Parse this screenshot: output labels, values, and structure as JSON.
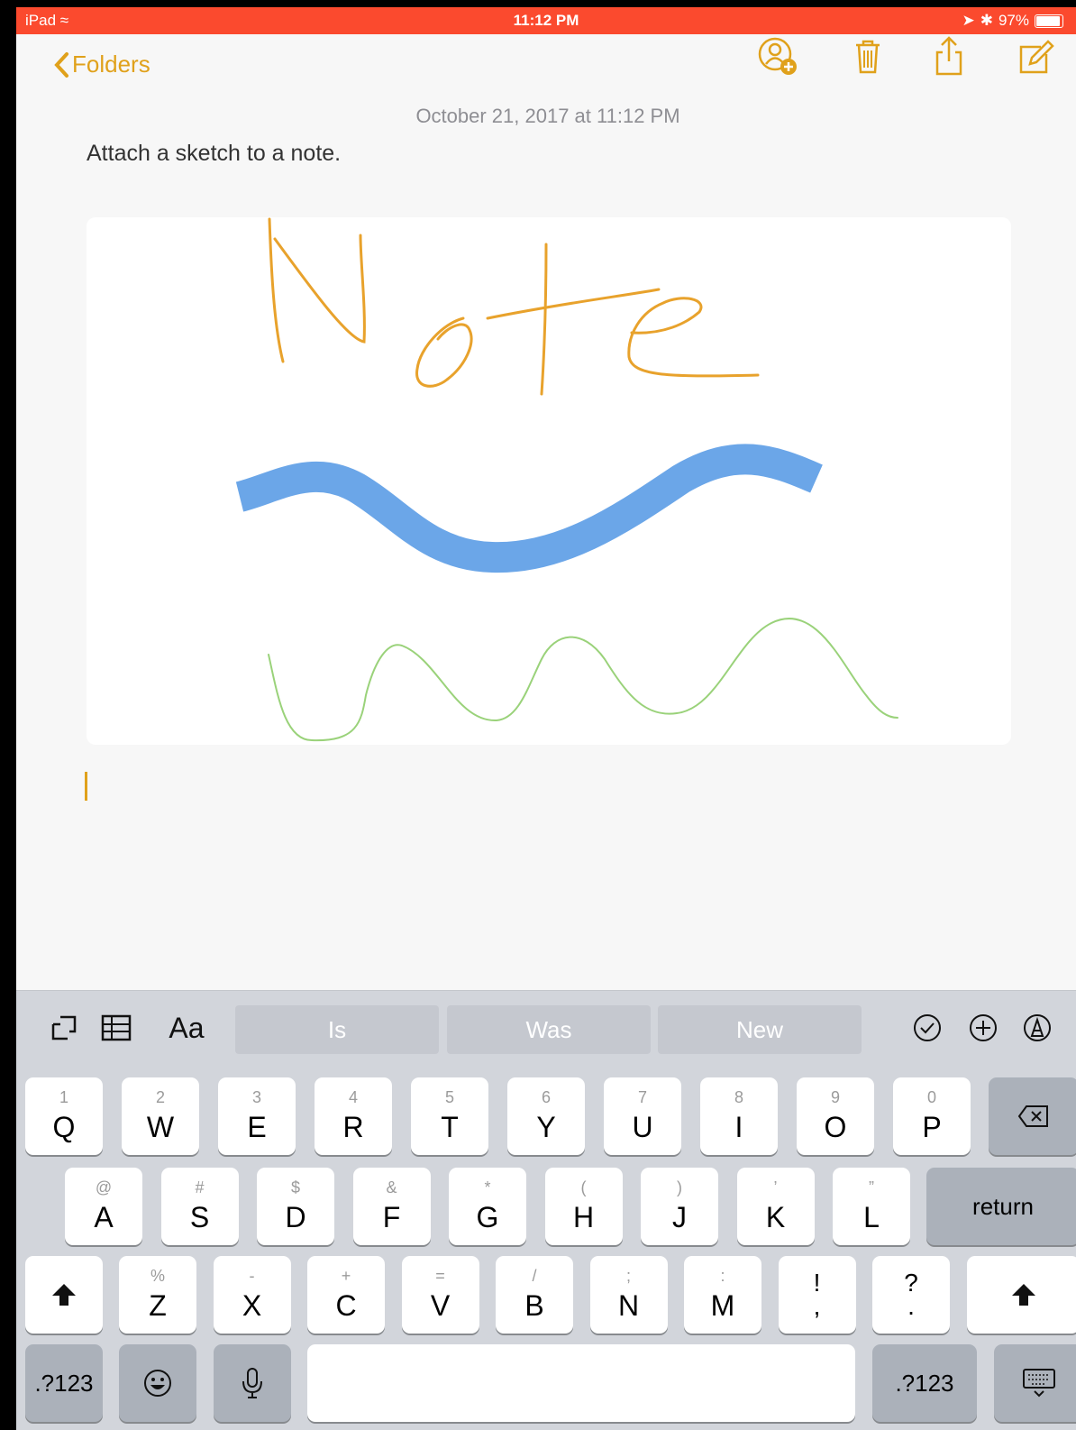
{
  "status": {
    "device": "iPad",
    "time": "11:12 PM",
    "battery": "97%"
  },
  "nav": {
    "back_label": "Folders"
  },
  "note": {
    "date": "October 21, 2017 at 11:12 PM",
    "text": "Attach a sketch to a note."
  },
  "keyboard": {
    "suggestions": [
      "Is",
      "Was",
      "New"
    ],
    "format_label": "Aa",
    "row1": [
      {
        "k": "Q",
        "s": "1"
      },
      {
        "k": "W",
        "s": "2"
      },
      {
        "k": "E",
        "s": "3"
      },
      {
        "k": "R",
        "s": "4"
      },
      {
        "k": "T",
        "s": "5"
      },
      {
        "k": "Y",
        "s": "6"
      },
      {
        "k": "U",
        "s": "7"
      },
      {
        "k": "I",
        "s": "8"
      },
      {
        "k": "O",
        "s": "9"
      },
      {
        "k": "P",
        "s": "0"
      }
    ],
    "row2": [
      {
        "k": "A",
        "s": "@"
      },
      {
        "k": "S",
        "s": "#"
      },
      {
        "k": "D",
        "s": "$"
      },
      {
        "k": "F",
        "s": "&"
      },
      {
        "k": "G",
        "s": "*"
      },
      {
        "k": "H",
        "s": "("
      },
      {
        "k": "J",
        "s": ")"
      },
      {
        "k": "K",
        "s": "’"
      },
      {
        "k": "L",
        "s": "”"
      }
    ],
    "row3": [
      {
        "k": "Z",
        "s": "%"
      },
      {
        "k": "X",
        "s": "-"
      },
      {
        "k": "C",
        "s": "+"
      },
      {
        "k": "V",
        "s": "="
      },
      {
        "k": "B",
        "s": "/"
      },
      {
        "k": "N",
        "s": ";"
      },
      {
        "k": "M",
        "s": ":"
      },
      {
        "k": "!\n,",
        "s": ""
      },
      {
        "k": "?\n.",
        "s": ""
      }
    ],
    "return_label": "return",
    "numbers_label": ".?123"
  },
  "colors": {
    "accent": "#e0a11b",
    "statusbar": "#fb4a2e",
    "highlighter": "#4a90e2",
    "pen_green": "#8ccf68"
  }
}
